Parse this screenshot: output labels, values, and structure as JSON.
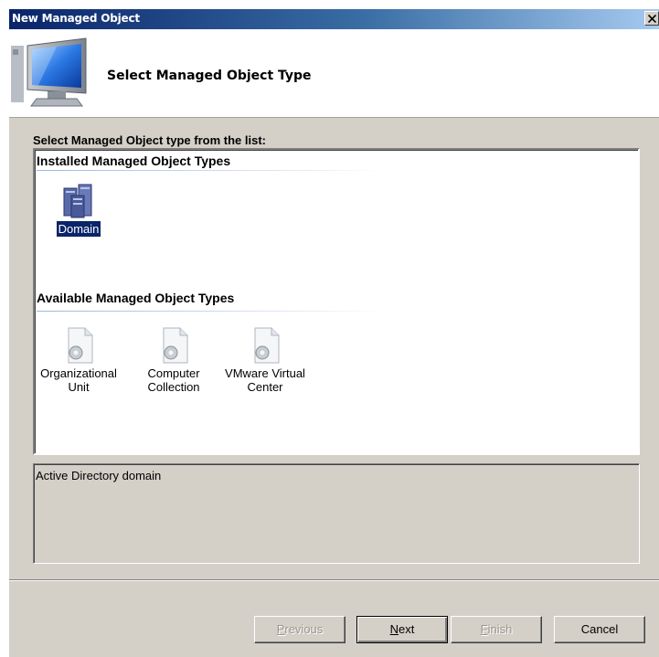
{
  "window": {
    "title": "New Managed Object"
  },
  "header": {
    "title": "Select Managed Object Type",
    "icon": "computer-monitor-icon"
  },
  "list": {
    "label": "Select Managed Object type from the list:",
    "groups": [
      {
        "header": "Installed Managed Object Types",
        "items": [
          {
            "label": "Domain",
            "icon": "server-stack-icon",
            "selected": true
          }
        ]
      },
      {
        "header": "Available Managed Object Types",
        "items": [
          {
            "label": "Organizational Unit",
            "icon": "gear-document-icon",
            "selected": false
          },
          {
            "label": "Computer Collection",
            "icon": "gear-document-icon",
            "selected": false
          },
          {
            "label": "VMware Virtual Center",
            "icon": "gear-document-icon",
            "selected": false
          }
        ]
      }
    ]
  },
  "description": {
    "text": "Active Directory domain"
  },
  "buttons": {
    "previous": {
      "mnemonic": "P",
      "rest": "revious",
      "enabled": false
    },
    "next": {
      "mnemonic": "N",
      "rest": "ext",
      "enabled": true
    },
    "finish": {
      "mnemonic": "F",
      "rest": "inish",
      "enabled": false
    },
    "cancel": {
      "label": "Cancel",
      "enabled": true
    }
  },
  "colors": {
    "titlebar": "#0a246a",
    "selection": "#0a246a",
    "dialog_bg": "#d4d0c8"
  }
}
